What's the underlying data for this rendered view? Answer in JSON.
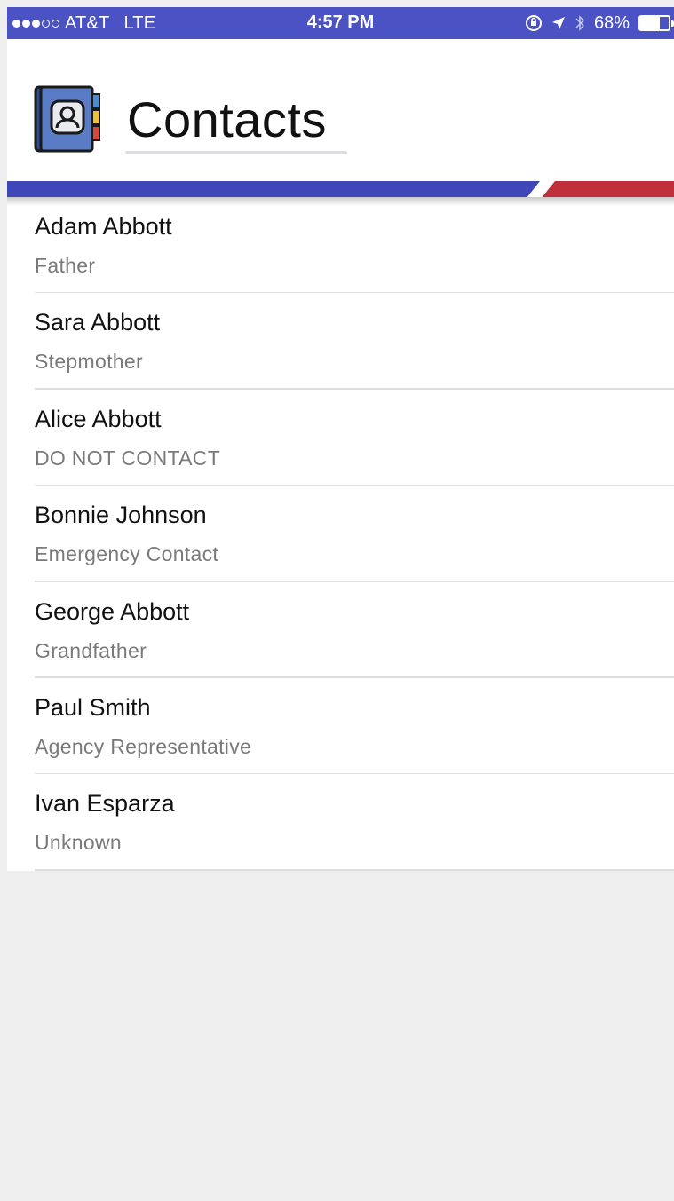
{
  "status_bar": {
    "carrier": "AT&T",
    "network": "LTE",
    "time": "4:57 PM",
    "battery": "68%",
    "signal_bars_filled": 3,
    "signal_bars_total": 5,
    "battery_level": 0.68,
    "icons": [
      "orientation-lock-icon",
      "location-arrow-icon",
      "bluetooth-icon",
      "battery-icon"
    ]
  },
  "header": {
    "title": "Contacts",
    "icon": "address-book-icon"
  },
  "colors": {
    "primary": "#4a52c4",
    "accent": "#c0303a",
    "background": "#efefef",
    "secondary_text": "#7a7a7a"
  },
  "contacts": [
    {
      "name": "Adam Abbott",
      "relation": "Father"
    },
    {
      "name": "Sara Abbott",
      "relation": "Stepmother"
    },
    {
      "name": "Alice Abbott",
      "relation": "DO NOT CONTACT"
    },
    {
      "name": "Bonnie Johnson",
      "relation": "Emergency Contact"
    },
    {
      "name": "George Abbott",
      "relation": "Grandfather"
    },
    {
      "name": "Paul Smith",
      "relation": "Agency Representative"
    },
    {
      "name": "Ivan Esparza",
      "relation": "Unknown"
    }
  ]
}
